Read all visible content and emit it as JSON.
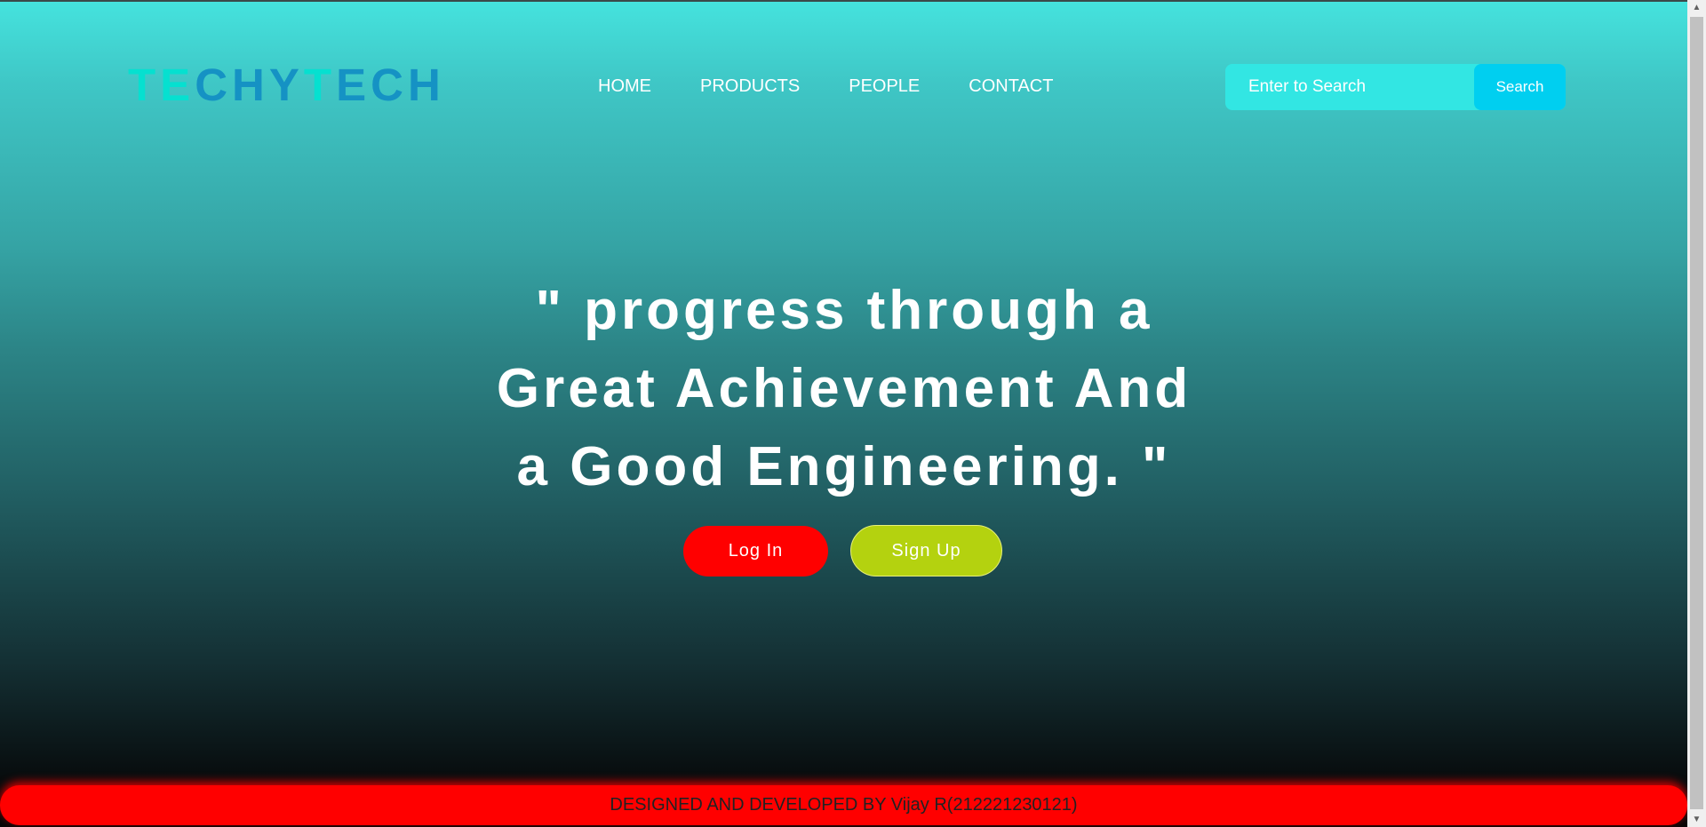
{
  "logo": {
    "letters": [
      {
        "char": "T",
        "color": "#06e0d0"
      },
      {
        "char": "E",
        "color": "#06e0d0"
      },
      {
        "char": "C",
        "color": "#1592c4"
      },
      {
        "char": "H",
        "color": "#1592c4"
      },
      {
        "char": "Y",
        "color": "#1592c4"
      },
      {
        "char": "T",
        "color": "#06e0d0"
      },
      {
        "char": "E",
        "color": "#1592c4"
      },
      {
        "char": "C",
        "color": "#1592c4"
      },
      {
        "char": "H",
        "color": "#1592c4"
      }
    ]
  },
  "nav": {
    "home": "HOME",
    "products": "PRODUCTS",
    "people": "PEOPLE",
    "contact": "CONTACT"
  },
  "search": {
    "placeholder": "Enter to Search",
    "button_label": "Search"
  },
  "hero": {
    "line1": "\" progress through a",
    "line2": "Great Achievement And",
    "line3": "a Good Engineering. \""
  },
  "buttons": {
    "login": "Log In",
    "signup": "Sign Up"
  },
  "footer": {
    "text": "DESIGNED AND DEVELOPED BY Vijay R(212221230121)"
  },
  "colors": {
    "login_bg": "#ff0000",
    "signup_bg": "#b4d20f",
    "search_bg": "#32e6e3",
    "search_button_bg": "#00cff0",
    "footer_bg": "#ff0000"
  },
  "scrollbar": {
    "up_arrow": "▲",
    "down_arrow": "▼"
  }
}
